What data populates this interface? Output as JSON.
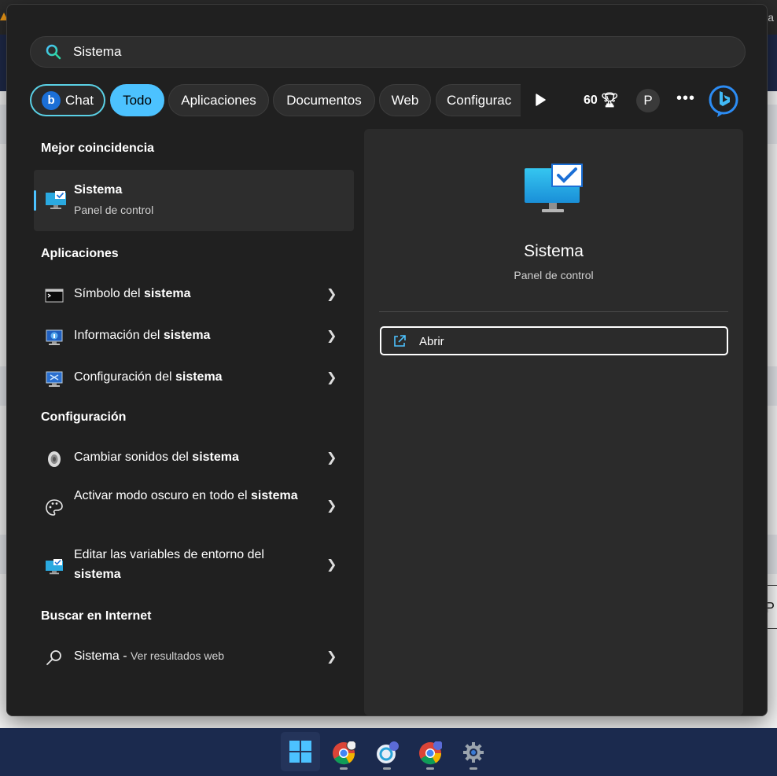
{
  "search": {
    "query": "Sistema"
  },
  "filters": {
    "chat": "Chat",
    "todo": "Todo",
    "apps": "Aplicaciones",
    "docs": "Documentos",
    "web": "Web",
    "config": "Configurac",
    "points": "60",
    "avatar": "P",
    "more": "•••"
  },
  "sections": {
    "best_match": "Mejor coincidencia",
    "apps": "Aplicaciones",
    "config": "Configuración",
    "internet": "Buscar en Internet"
  },
  "best_match": {
    "title": "Sistema",
    "subtitle": "Panel de control"
  },
  "apps": [
    {
      "prefix": "Símbolo del ",
      "bold": "sistema"
    },
    {
      "prefix": "Información del ",
      "bold": "sistema"
    },
    {
      "prefix": "Configuración del ",
      "bold": "sistema"
    }
  ],
  "config_items": [
    {
      "prefix": "Cambiar sonidos del ",
      "bold": "sistema"
    },
    {
      "prefix": "Activar modo oscuro en todo el ",
      "bold": "sistema"
    },
    {
      "prefix": "Editar las variables de entorno del ",
      "bold": "sistema"
    }
  ],
  "web_result": {
    "query": "Sistema",
    "suffix": " - ",
    "sub": "Ver resultados web"
  },
  "detail": {
    "title": "Sistema",
    "subtitle": "Panel de control",
    "open_label": "Abrir"
  },
  "colors": {
    "accent": "#4cc2ff",
    "panel": "#202020",
    "taskbar": "#1b2a4e"
  }
}
